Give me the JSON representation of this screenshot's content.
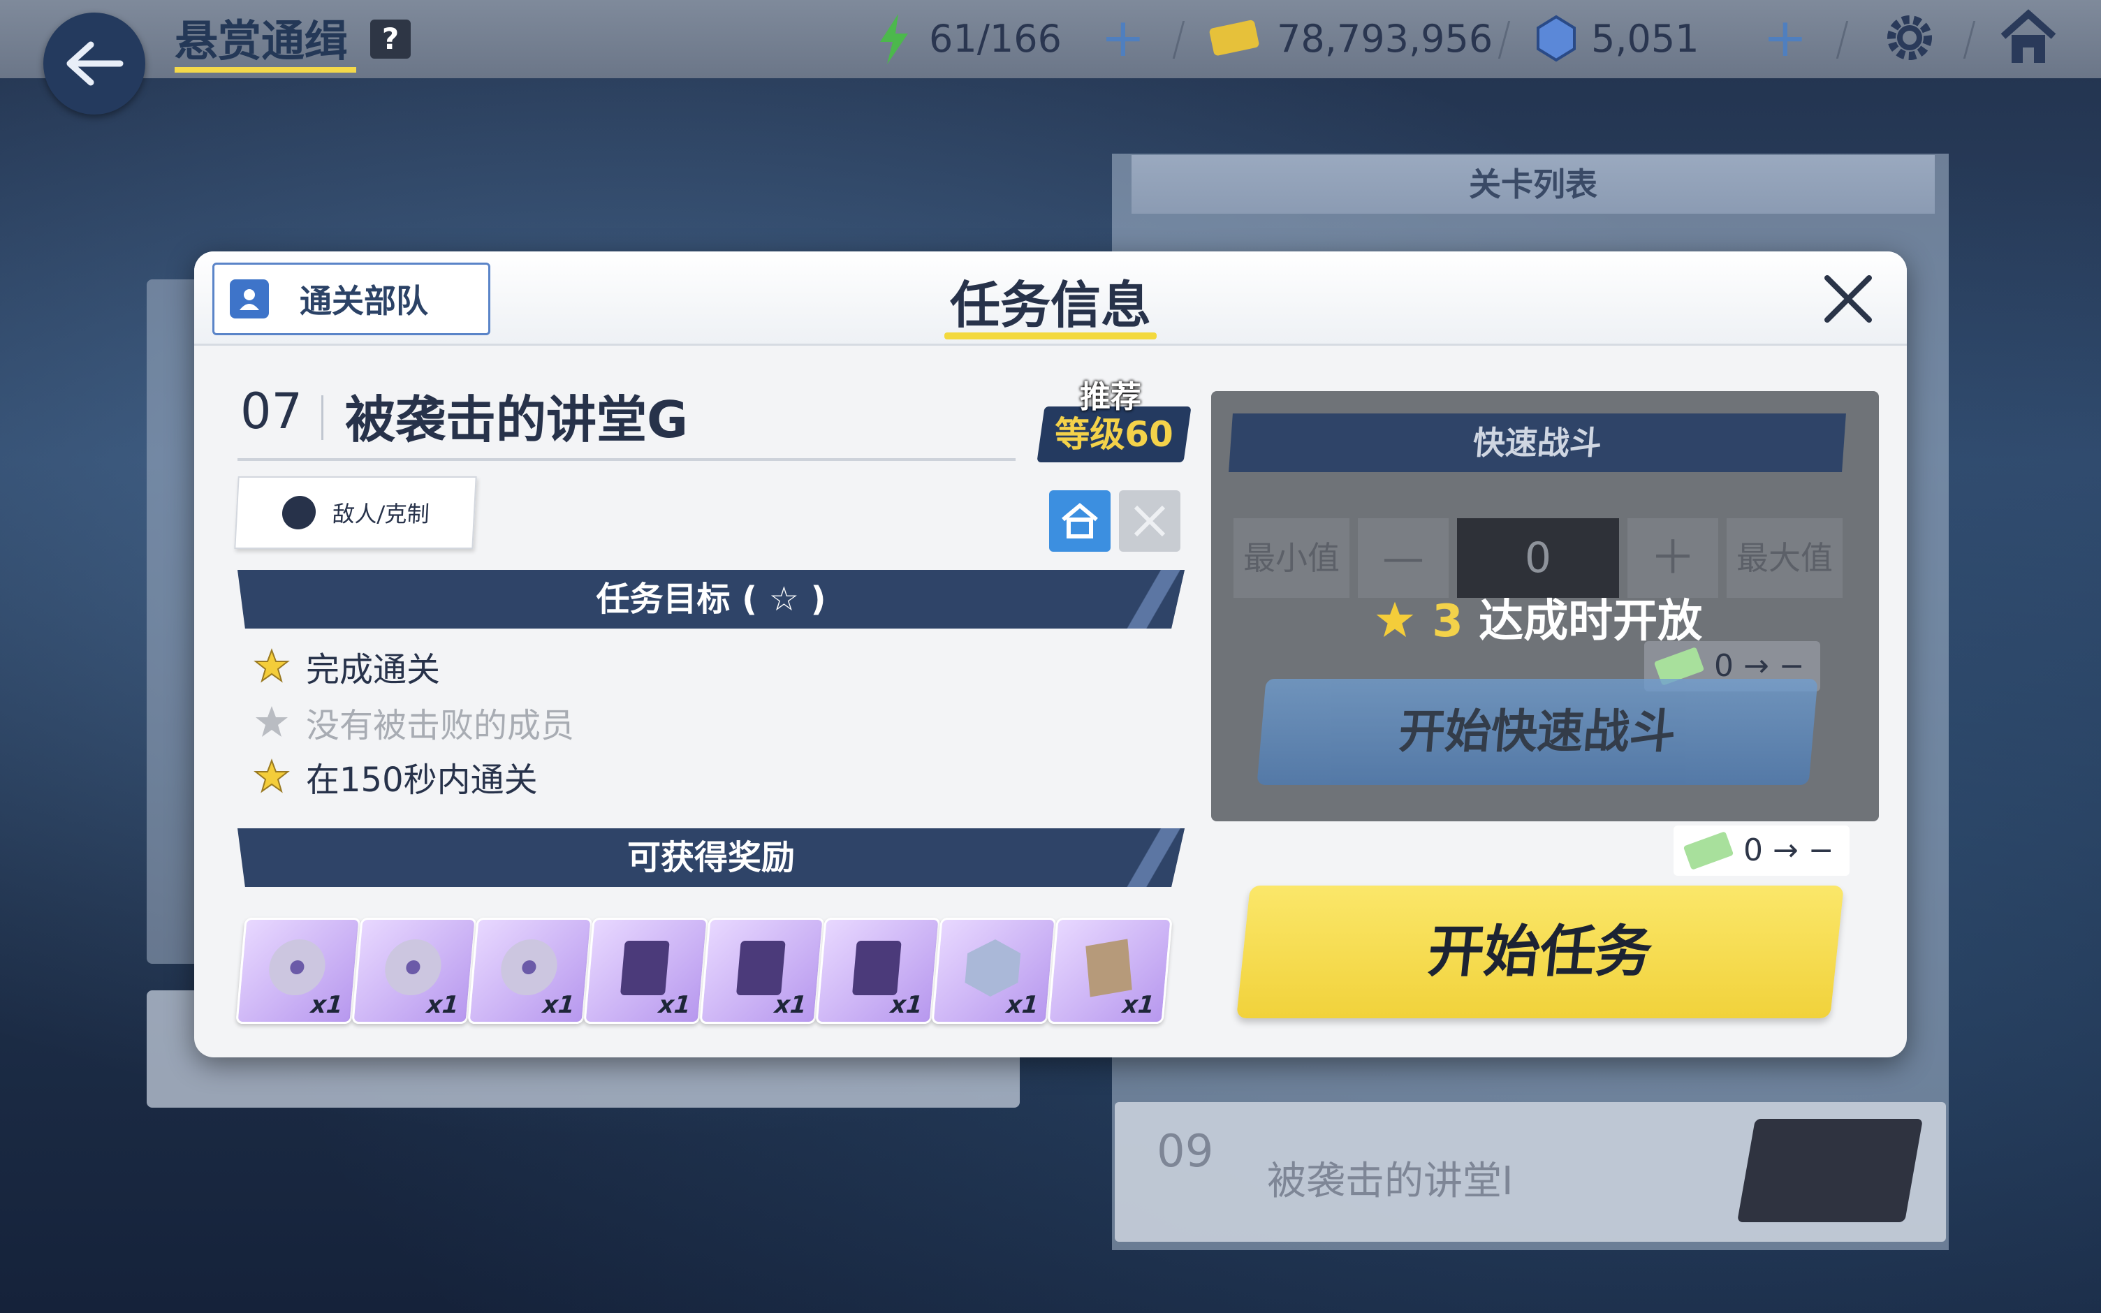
{
  "topbar": {
    "title": "悬赏通缉",
    "help": "?",
    "ap": "61/166",
    "credits": "78,793,956",
    "gems": "5,051"
  },
  "bg_list": {
    "header": "关卡列表",
    "row09_num": "09",
    "row09_name": "被袭击的讲堂I"
  },
  "modal": {
    "team_button": "通关部队",
    "title": "任务信息",
    "stage_number": "07",
    "stage_name": "被袭击的讲堂G",
    "recommend_label": "推荐",
    "recommend_level": "等级60",
    "enemy_button": "敌人/克制",
    "objectives_header": "任务目标 ( ☆ )",
    "objectives": [
      {
        "text": "完成通关",
        "achieved": true
      },
      {
        "text": "没有被击败的成员",
        "achieved": false
      },
      {
        "text": "在150秒内通关",
        "achieved": true
      }
    ],
    "rewards_header": "可获得奖励",
    "rewards": [
      {
        "qty": "x1"
      },
      {
        "qty": "x1"
      },
      {
        "qty": "x1"
      },
      {
        "qty": "x1"
      },
      {
        "qty": "x1"
      },
      {
        "qty": "x1"
      },
      {
        "qty": "x1"
      },
      {
        "qty": "x1"
      }
    ]
  },
  "quick_battle": {
    "title": "快速战斗",
    "min_label": "最小值",
    "minus": "—",
    "count": "0",
    "plus": "＋",
    "max_label": "最大值",
    "unlock_stars": "3",
    "unlock_text": "达成时开放",
    "quick_cost": "0 → −",
    "quick_start": "开始快速战斗"
  },
  "start": {
    "cost": "0 → −",
    "label": "开始任务"
  },
  "colors": {
    "accent_yellow": "#f3d93e",
    "navy": "#2f4468",
    "button_blue": "#3c8fe0"
  }
}
